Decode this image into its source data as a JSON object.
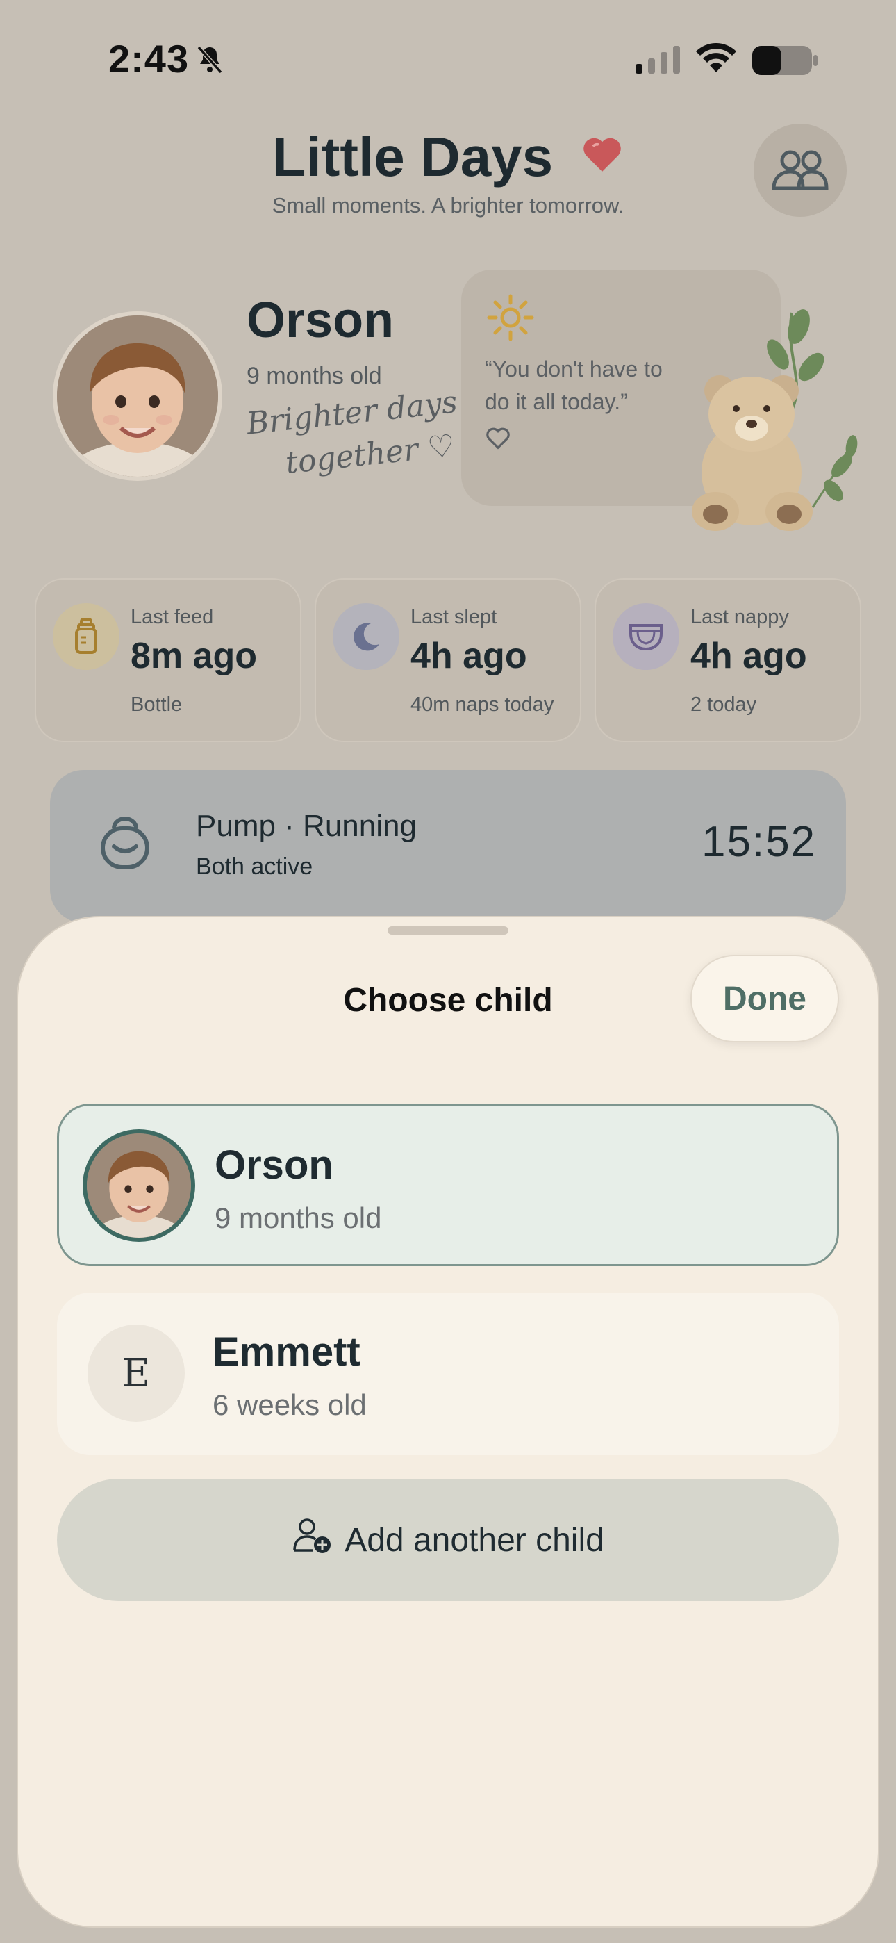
{
  "status_bar": {
    "time": "2:43"
  },
  "header": {
    "title": "Little Days",
    "subtitle": "Small moments. A brighter tomorrow."
  },
  "profile": {
    "name": "Orson",
    "age": "9 months old",
    "tagline_line1": "Brighter days",
    "tagline_line2": "together ♡"
  },
  "quote": {
    "text": "“You don't have to do it all today.”"
  },
  "stats": [
    {
      "label": "Last feed",
      "value": "8m ago",
      "sub": "Bottle"
    },
    {
      "label": "Last slept",
      "value": "4h ago",
      "sub": "40m naps today"
    },
    {
      "label": "Last nappy",
      "value": "4h ago",
      "sub": "2 today"
    }
  ],
  "pump": {
    "title": "Pump · Running",
    "subtitle": "Both active",
    "timer": "15:52"
  },
  "sheet": {
    "title": "Choose child",
    "done_label": "Done",
    "children": [
      {
        "name": "Orson",
        "age": "9 months old",
        "selected": true
      },
      {
        "name": "Emmett",
        "age": "6 weeks old",
        "initial": "E",
        "selected": false
      }
    ],
    "add_label": "Add another child"
  },
  "colors": {
    "accent": "#3d6a62",
    "sheet_bg": "#f5ede1",
    "selected_row_bg": "#e7eee8",
    "dimmed_bg": "#c6bfb5"
  },
  "icons": [
    "bell-slash-icon",
    "signal-icon",
    "wifi-icon",
    "battery-icon",
    "heart-icon",
    "family-icon",
    "sun-icon",
    "bottle-icon",
    "moon-icon",
    "nappy-icon",
    "pump-icon",
    "add-person-icon"
  ]
}
